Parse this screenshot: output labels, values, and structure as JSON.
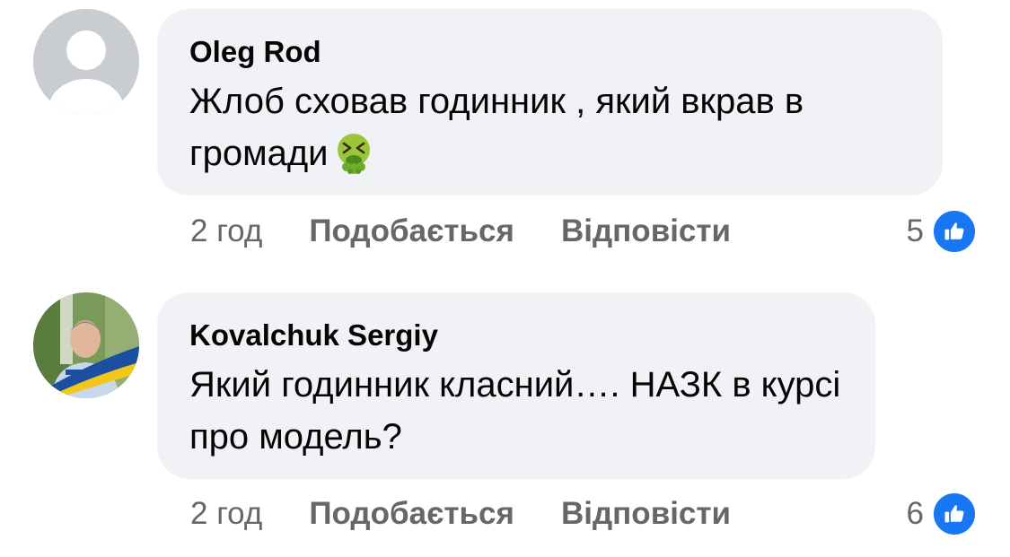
{
  "comments": [
    {
      "author": "Oleg Rod",
      "text": "Жлоб сховав годинник , який вкрав в громади",
      "emoji": "nauseated-face-icon",
      "time": "2 год",
      "like_label": "Подобається",
      "reply_label": "Відповісти",
      "reaction_count": "5"
    },
    {
      "author": "Kovalchuk Sergiy",
      "text": "Який годинник класний…. НАЗК в курсі про модель?",
      "time": "2 год",
      "like_label": "Подобається",
      "reply_label": "Відповісти",
      "reaction_count": "6"
    }
  ],
  "colors": {
    "bubble": "#f0f2f5",
    "meta_text": "#65676b",
    "like_blue": "#1877f2"
  }
}
